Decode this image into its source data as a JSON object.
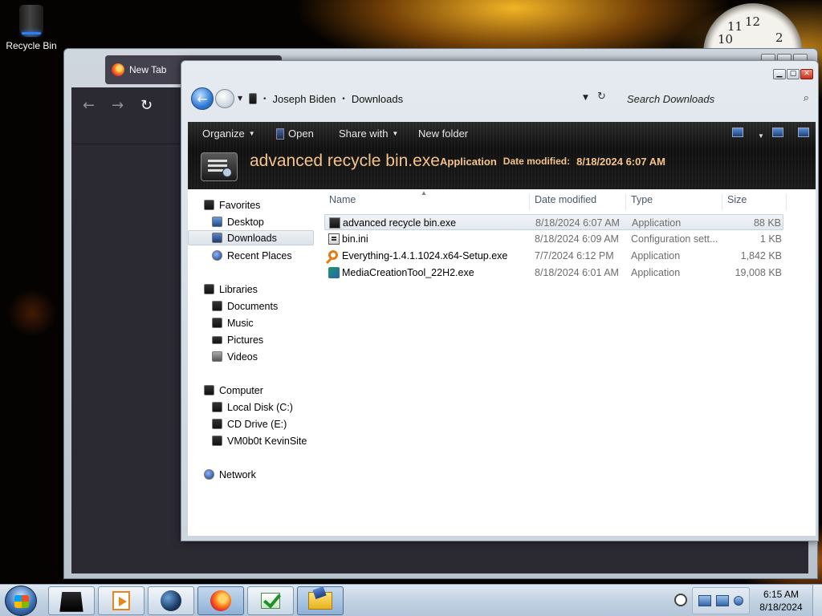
{
  "desktop": {
    "icons": [
      {
        "label": "Recycle Bin",
        "icon": "recycle-bin-icon"
      }
    ],
    "clock_numerals": [
      "11",
      "12",
      "10",
      "2"
    ]
  },
  "browser": {
    "tab_title": "New Tab",
    "nav": {
      "back": "←",
      "forward": "→",
      "reload": "↻"
    }
  },
  "explorer": {
    "address": {
      "crumbs": [
        "Joseph Biden",
        "Downloads"
      ],
      "separator": "•"
    },
    "search": {
      "placeholder": "Search Downloads"
    },
    "toolbar": {
      "organize": "Organize",
      "open": "Open",
      "share_with": "Share with",
      "new_folder": "New folder"
    },
    "details": {
      "name": "advanced recycle bin.exe",
      "type": "Application",
      "modified_label": "Date modified:",
      "modified_value": "8/18/2024 6:07 AM"
    },
    "navpane": {
      "favorites": {
        "label": "Favorites",
        "items": [
          "Desktop",
          "Downloads",
          "Recent Places"
        ]
      },
      "libraries": {
        "label": "Libraries",
        "items": [
          "Documents",
          "Music",
          "Pictures",
          "Videos"
        ]
      },
      "computer": {
        "label": "Computer",
        "items": [
          "Local Disk (C:)",
          "CD Drive (E:)",
          "VM0b0t KevinSite"
        ]
      },
      "network": {
        "label": "Network"
      },
      "selected": "Downloads"
    },
    "columns": {
      "name": "Name",
      "date": "Date modified",
      "type": "Type",
      "size": "Size"
    },
    "files": [
      {
        "name": "advanced recycle bin.exe",
        "date": "8/18/2024 6:07 AM",
        "type": "Application",
        "size": "88 KB",
        "icon": "application-icon",
        "selected": true
      },
      {
        "name": "bin.ini",
        "date": "8/18/2024 6:09 AM",
        "type": "Configuration sett...",
        "size": "1 KB",
        "icon": "config-file-icon"
      },
      {
        "name": "Everything-1.4.1.1024.x64-Setup.exe",
        "date": "7/7/2024 6:12 PM",
        "type": "Application",
        "size": "1,842 KB",
        "icon": "everything-search-icon"
      },
      {
        "name": "MediaCreationTool_22H2.exe",
        "date": "8/18/2024 6:01 AM",
        "type": "Application",
        "size": "19,008 KB",
        "icon": "media-creation-tool-icon"
      }
    ]
  },
  "taskbar": {
    "apps": [
      "black-box-icon",
      "media-player-icon",
      "globe-icon",
      "firefox-icon",
      "checkmark-app-icon",
      "file-explorer-icon"
    ],
    "time": "6:15 AM",
    "date": "8/18/2024"
  },
  "colors": {
    "detail_text": "#f6c48a",
    "accent_blue": "#2f7bd6",
    "browser_dark": "#2b2a33"
  }
}
